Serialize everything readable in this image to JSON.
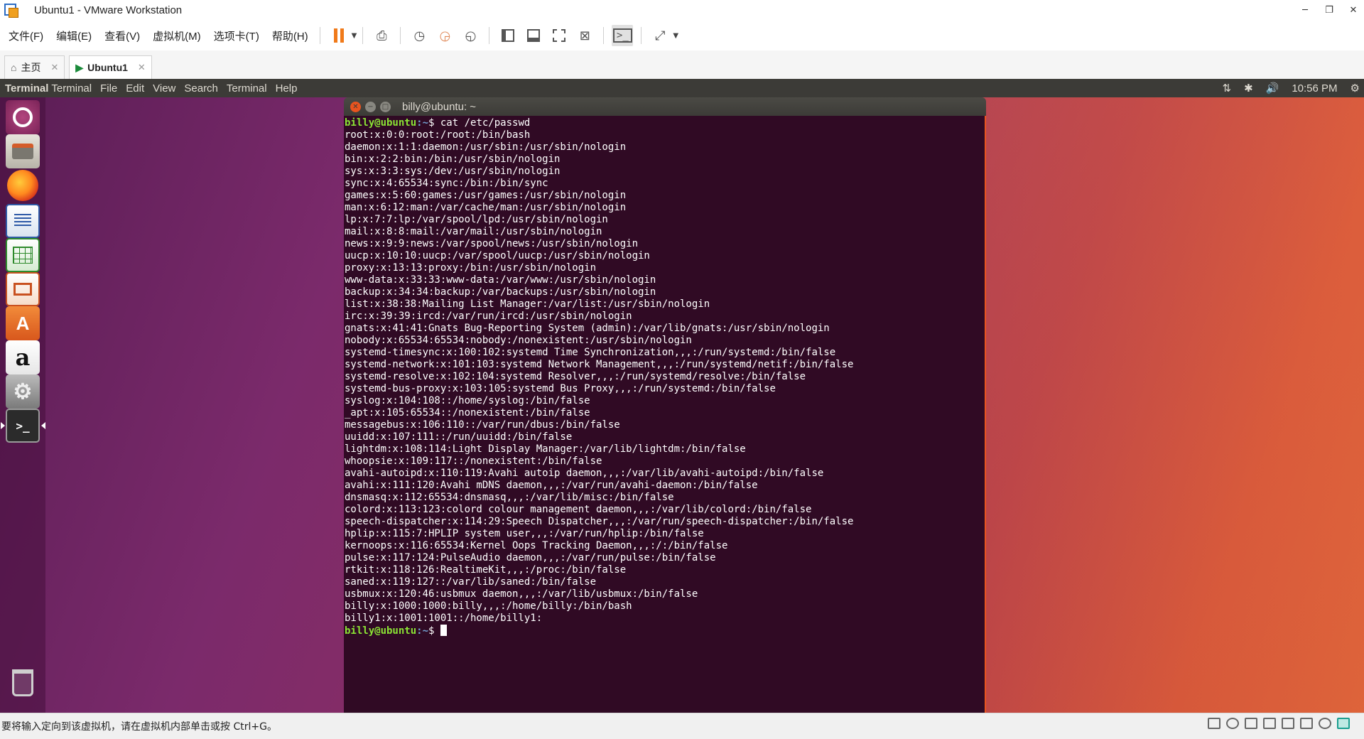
{
  "window": {
    "title": "Ubuntu1 - VMware Workstation",
    "controls": {
      "minimize": "─",
      "restore": "❐",
      "close": "✕"
    }
  },
  "menu": [
    "文件(F)",
    "编辑(E)",
    "查看(V)",
    "虚拟机(M)",
    "选项卡(T)",
    "帮助(H)"
  ],
  "toolbar": {
    "icons": [
      "pause-icon",
      "send-ctrl-alt-del-icon",
      "snapshot-take-icon",
      "snapshot-revert-icon",
      "snapshot-manager-icon",
      "library-view-icon",
      "thumbnail-view-icon",
      "fullscreen-icon",
      "unity-icon",
      "console-view-icon",
      "stretch-icon"
    ],
    "accent": "#f07a1a"
  },
  "tabs": [
    {
      "label": "主页",
      "icon": "home-icon",
      "close": "✕",
      "active": false
    },
    {
      "label": "Ubuntu1",
      "icon": "vm-icon",
      "close": "✕",
      "active": true
    }
  ],
  "top_panel": {
    "app": "Terminal",
    "menus": [
      "Terminal",
      "File",
      "Edit",
      "View",
      "Search",
      "Terminal",
      "Help"
    ],
    "network": "⇅",
    "bluetooth": "✱",
    "volume": "🔊",
    "time": "10:56 PM",
    "power": "⚙"
  },
  "launcher": [
    "ubuntu-dash-icon",
    "files-icon",
    "firefox-icon",
    "libreoffice-writer-icon",
    "libreoffice-calc-icon",
    "libreoffice-impress-icon",
    "software-center-icon",
    "amazon-icon",
    "system-settings-icon",
    "terminal-icon",
    "trash-icon"
  ],
  "launcher_glyphs": {
    "store": "A",
    "amazon": "a",
    "settings": "⚙",
    "terminal": ">_"
  },
  "terminal": {
    "title": "billy@ubuntu: ~",
    "prompt_user": "billy@ubuntu",
    "prompt_path": ":~",
    "prompt_symbol": "$ ",
    "command": "cat /etc/passwd",
    "output": [
      "root:x:0:0:root:/root:/bin/bash",
      "daemon:x:1:1:daemon:/usr/sbin:/usr/sbin/nologin",
      "bin:x:2:2:bin:/bin:/usr/sbin/nologin",
      "sys:x:3:3:sys:/dev:/usr/sbin/nologin",
      "sync:x:4:65534:sync:/bin:/bin/sync",
      "games:x:5:60:games:/usr/games:/usr/sbin/nologin",
      "man:x:6:12:man:/var/cache/man:/usr/sbin/nologin",
      "lp:x:7:7:lp:/var/spool/lpd:/usr/sbin/nologin",
      "mail:x:8:8:mail:/var/mail:/usr/sbin/nologin",
      "news:x:9:9:news:/var/spool/news:/usr/sbin/nologin",
      "uucp:x:10:10:uucp:/var/spool/uucp:/usr/sbin/nologin",
      "proxy:x:13:13:proxy:/bin:/usr/sbin/nologin",
      "www-data:x:33:33:www-data:/var/www:/usr/sbin/nologin",
      "backup:x:34:34:backup:/var/backups:/usr/sbin/nologin",
      "list:x:38:38:Mailing List Manager:/var/list:/usr/sbin/nologin",
      "irc:x:39:39:ircd:/var/run/ircd:/usr/sbin/nologin",
      "gnats:x:41:41:Gnats Bug-Reporting System (admin):/var/lib/gnats:/usr/sbin/nologin",
      "nobody:x:65534:65534:nobody:/nonexistent:/usr/sbin/nologin",
      "systemd-timesync:x:100:102:systemd Time Synchronization,,,:/run/systemd:/bin/false",
      "systemd-network:x:101:103:systemd Network Management,,,:/run/systemd/netif:/bin/false",
      "systemd-resolve:x:102:104:systemd Resolver,,,:/run/systemd/resolve:/bin/false",
      "systemd-bus-proxy:x:103:105:systemd Bus Proxy,,,:/run/systemd:/bin/false",
      "syslog:x:104:108::/home/syslog:/bin/false",
      "_apt:x:105:65534::/nonexistent:/bin/false",
      "messagebus:x:106:110::/var/run/dbus:/bin/false",
      "uuidd:x:107:111::/run/uuidd:/bin/false",
      "lightdm:x:108:114:Light Display Manager:/var/lib/lightdm:/bin/false",
      "whoopsie:x:109:117::/nonexistent:/bin/false",
      "avahi-autoipd:x:110:119:Avahi autoip daemon,,,:/var/lib/avahi-autoipd:/bin/false",
      "avahi:x:111:120:Avahi mDNS daemon,,,:/var/run/avahi-daemon:/bin/false",
      "dnsmasq:x:112:65534:dnsmasq,,,:/var/lib/misc:/bin/false",
      "colord:x:113:123:colord colour management daemon,,,:/var/lib/colord:/bin/false",
      "speech-dispatcher:x:114:29:Speech Dispatcher,,,:/var/run/speech-dispatcher:/bin/false",
      "hplip:x:115:7:HPLIP system user,,,:/var/run/hplip:/bin/false",
      "kernoops:x:116:65534:Kernel Oops Tracking Daemon,,,:/:/bin/false",
      "pulse:x:117:124:PulseAudio daemon,,,:/var/run/pulse:/bin/false",
      "rtkit:x:118:126:RealtimeKit,,,:/proc:/bin/false",
      "saned:x:119:127::/var/lib/saned:/bin/false",
      "usbmux:x:120:46:usbmux daemon,,,:/var/lib/usbmux:/bin/false",
      "billy:x:1000:1000:billy,,,:/home/billy:/bin/bash",
      "billy1:x:1001:1001::/home/billy1:"
    ],
    "colors": {
      "background": "#300a24",
      "user": "#8ae234",
      "path": "#729fcf",
      "text": "#ffffff"
    }
  },
  "status": {
    "message": "要将输入定向到该虚拟机，请在虚拟机内部单击或按 Ctrl+G。"
  }
}
